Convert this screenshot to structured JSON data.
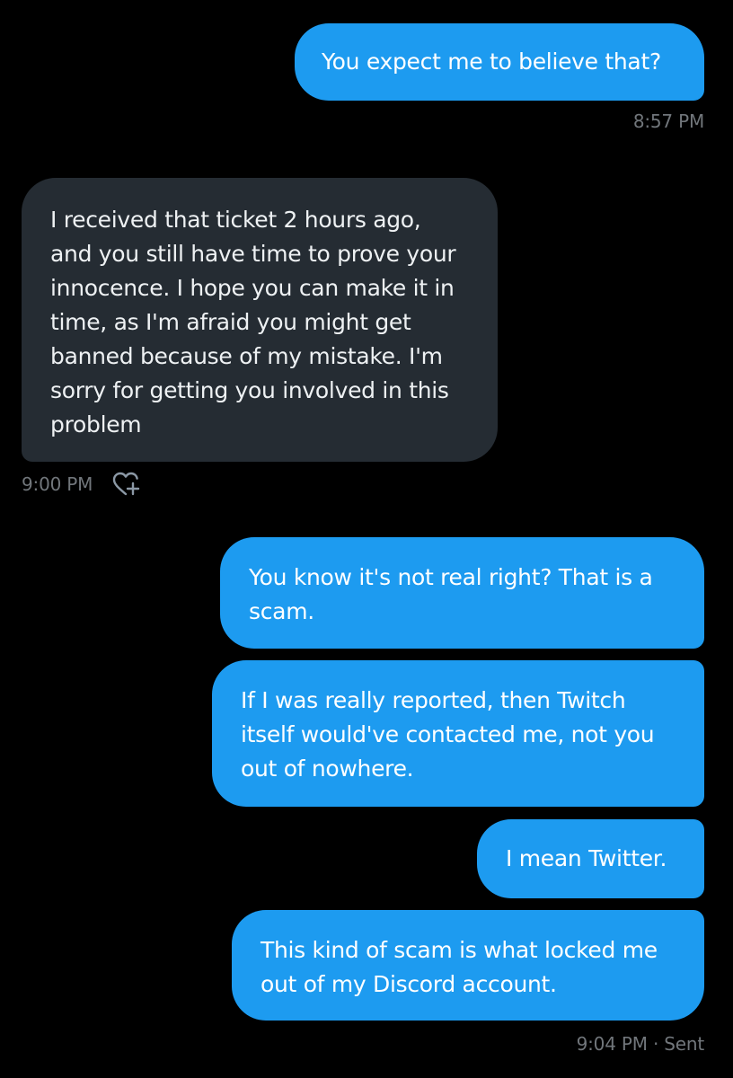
{
  "messages": [
    {
      "text": "You expect me to believe that?",
      "direction": "sent"
    },
    {
      "text": "I received that ticket 2 hours ago, and you still have time to prove your innocence. I hope you can make it in time, as I'm afraid you might get banned because of my mistake. I'm sorry for getting you involved in this problem",
      "direction": "received"
    },
    {
      "text": "You know it's not real right?  That is a scam.",
      "direction": "sent"
    },
    {
      "text": "If I was really reported, then Twitch itself would've contacted me, not you out of nowhere.",
      "direction": "sent"
    },
    {
      "text": "I mean Twitter.",
      "direction": "sent"
    },
    {
      "text": "This kind of scam is what locked me out of my Discord account.",
      "direction": "sent"
    }
  ],
  "timestamps": {
    "t1": "8:57 PM",
    "t2": "9:00 PM",
    "t3": "9:04 PM · Sent"
  },
  "icons": {
    "react": "heart-plus-icon"
  },
  "colors": {
    "background": "#000000",
    "sent_bubble": "#1d9bf0",
    "received_bubble": "#252c33",
    "meta_text": "#71767b"
  }
}
